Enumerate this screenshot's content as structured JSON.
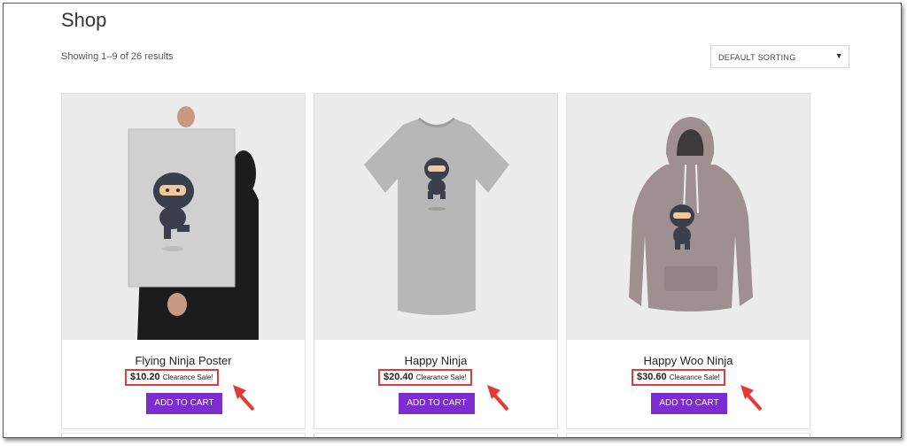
{
  "page": {
    "title": "Shop",
    "results_text": "Showing 1–9 of 26 results"
  },
  "sorting": {
    "selected": "DEFAULT SORTING",
    "icon": "caret-down-icon"
  },
  "products": [
    {
      "name": "Flying Ninja Poster",
      "price": "$10.20",
      "sale_label": "Clearance Sale!",
      "button": "ADD TO CART"
    },
    {
      "name": "Happy Ninja",
      "price": "$20.40",
      "sale_label": "Clearance Sale!",
      "button": "ADD TO CART"
    },
    {
      "name": "Happy Woo Ninja",
      "price": "$30.60",
      "sale_label": "Clearance Sale!",
      "button": "ADD TO CART"
    }
  ],
  "colors": {
    "button": "#7b2dd0",
    "highlight": "#e53935",
    "image_bg": "#ececec"
  }
}
